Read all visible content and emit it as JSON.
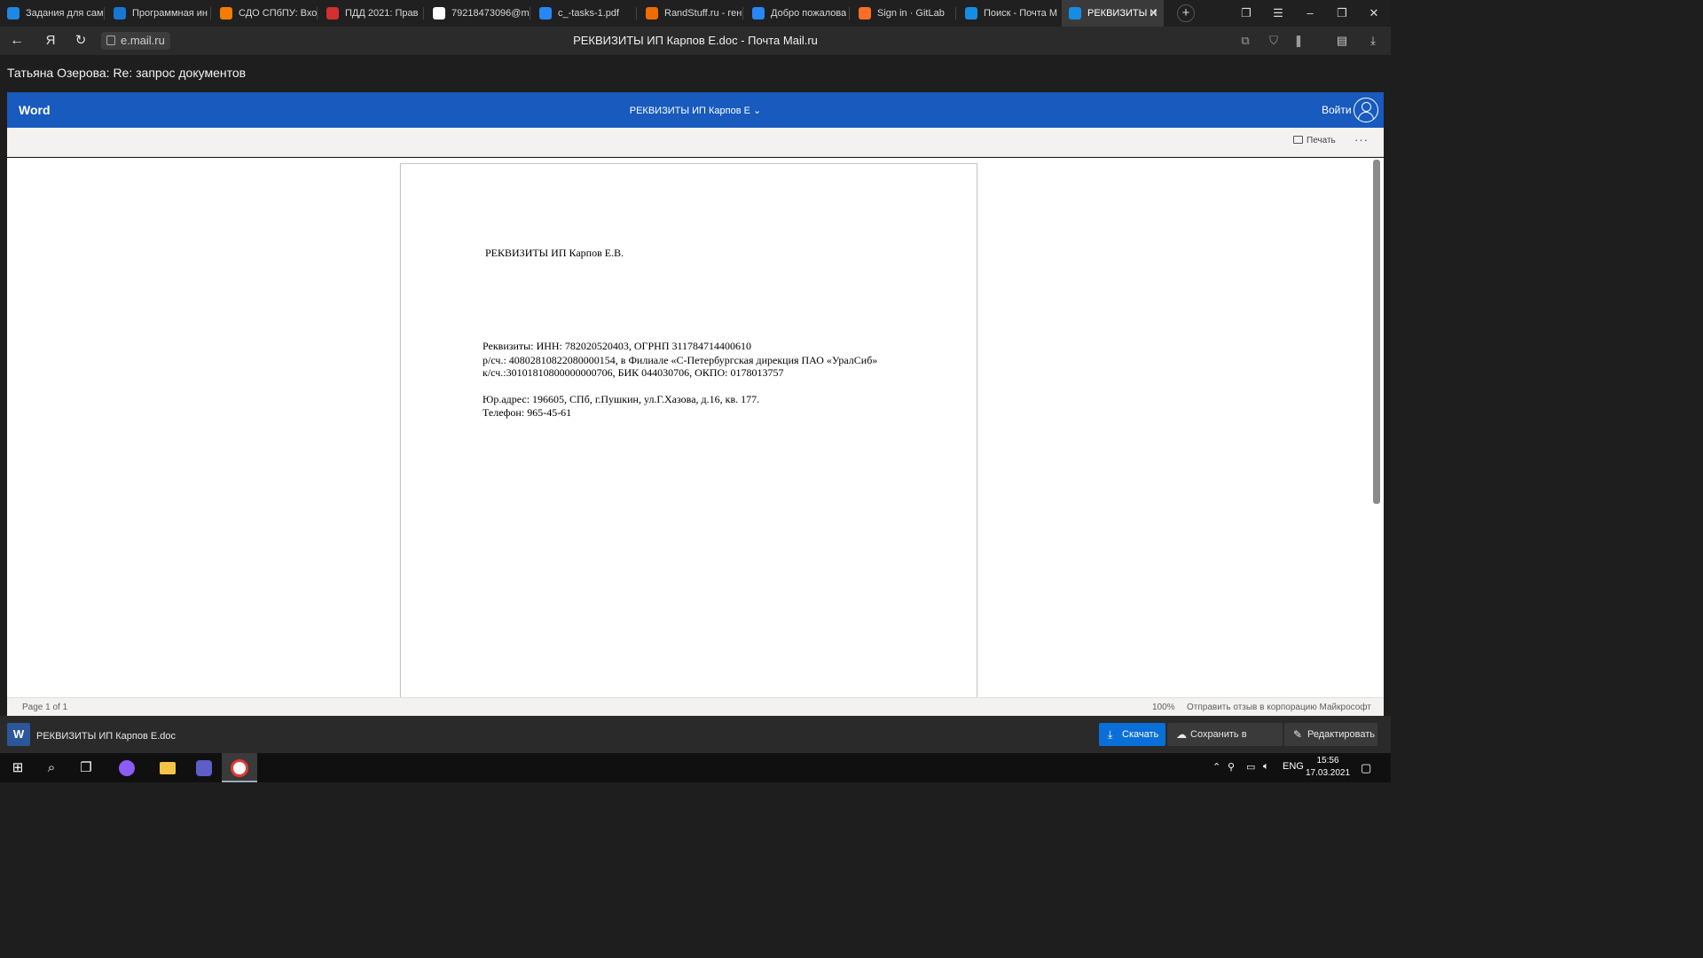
{
  "browser": {
    "tabs": [
      {
        "title": "Задания для сам",
        "icon": "spinner-icon",
        "color": "#1e88e5"
      },
      {
        "title": "Программная ин",
        "icon": "swoosh-icon",
        "color": "#1976d2"
      },
      {
        "title": "СДО СПбПУ: Вхо",
        "icon": "moodle-icon",
        "color": "#f57c00"
      },
      {
        "title": "ПДД 2021: Прав",
        "icon": "gear-icon",
        "color": "#d32f2f"
      },
      {
        "title": "79218473096@m",
        "icon": "doc-icon",
        "color": "#ffffff"
      },
      {
        "title": "c_-tasks-1.pdf",
        "icon": "vk-icon",
        "color": "#2787f5"
      },
      {
        "title": "RandStuff.ru - ген",
        "icon": "rs-icon",
        "color": "#ef6c00"
      },
      {
        "title": "Добро пожалова",
        "icon": "vk-icon",
        "color": "#2787f5"
      },
      {
        "title": "Sign in · GitLab",
        "icon": "gitlab-icon",
        "color": "#fc6d26"
      },
      {
        "title": "Поиск - Почта М",
        "icon": "mail-icon",
        "color": "#168de2"
      },
      {
        "title": "РЕКВИЗИТЫ И",
        "icon": "mail-icon",
        "color": "#168de2"
      }
    ],
    "address": "e.mail.ru",
    "yandex_glyph": "Я",
    "page_title": "РЕКВИЗИТЫ ИП Карпов Е.doc - Почта Mail.ru"
  },
  "mail": {
    "subject_line": "Татьяна Озерова: Re: запрос документов"
  },
  "word": {
    "app_name": "Word",
    "doc_title": "РЕКВИЗИТЫ ИП Карпов Е",
    "chevron": "⌄",
    "signin": "Войти",
    "print": "Печать",
    "more": "···",
    "document": {
      "heading": "РЕКВИЗИТЫ ИП Карпов Е.В.",
      "lines": [
        "Реквизиты: ИНН: 782020520403, ОГРНП 311784714400610",
        " р/сч.:  40802810822080000154, в Филиале «С-Петербургская дирекция ПАО «УралСиб»",
        "к/сч.:30101810800000000706, БИК 044030706, ОКПО: 0178013757",
        "Юр.адрес:  196605, СПб, г.Пушкин, ул.Г.Хазова, д.16, кв. 177.",
        " Телефон:  965-45-61"
      ]
    },
    "status": {
      "page": "Page 1 of 1",
      "zoom": "100%",
      "feedback": "Отправить отзыв в корпорацию Майкрософт"
    }
  },
  "attachment": {
    "icon_letter": "W",
    "filename": "РЕКВИЗИТЫ ИП Карпов Е.doc",
    "download": "Скачать",
    "save_cloud": "Сохранить в Облако",
    "edit": "Редактировать"
  },
  "taskbar": {
    "lang": "ENG",
    "time": "15:56",
    "date": "17.03.2021"
  },
  "colors": {
    "word_blue": "#185abd",
    "download_blue": "#0a6fd8"
  }
}
